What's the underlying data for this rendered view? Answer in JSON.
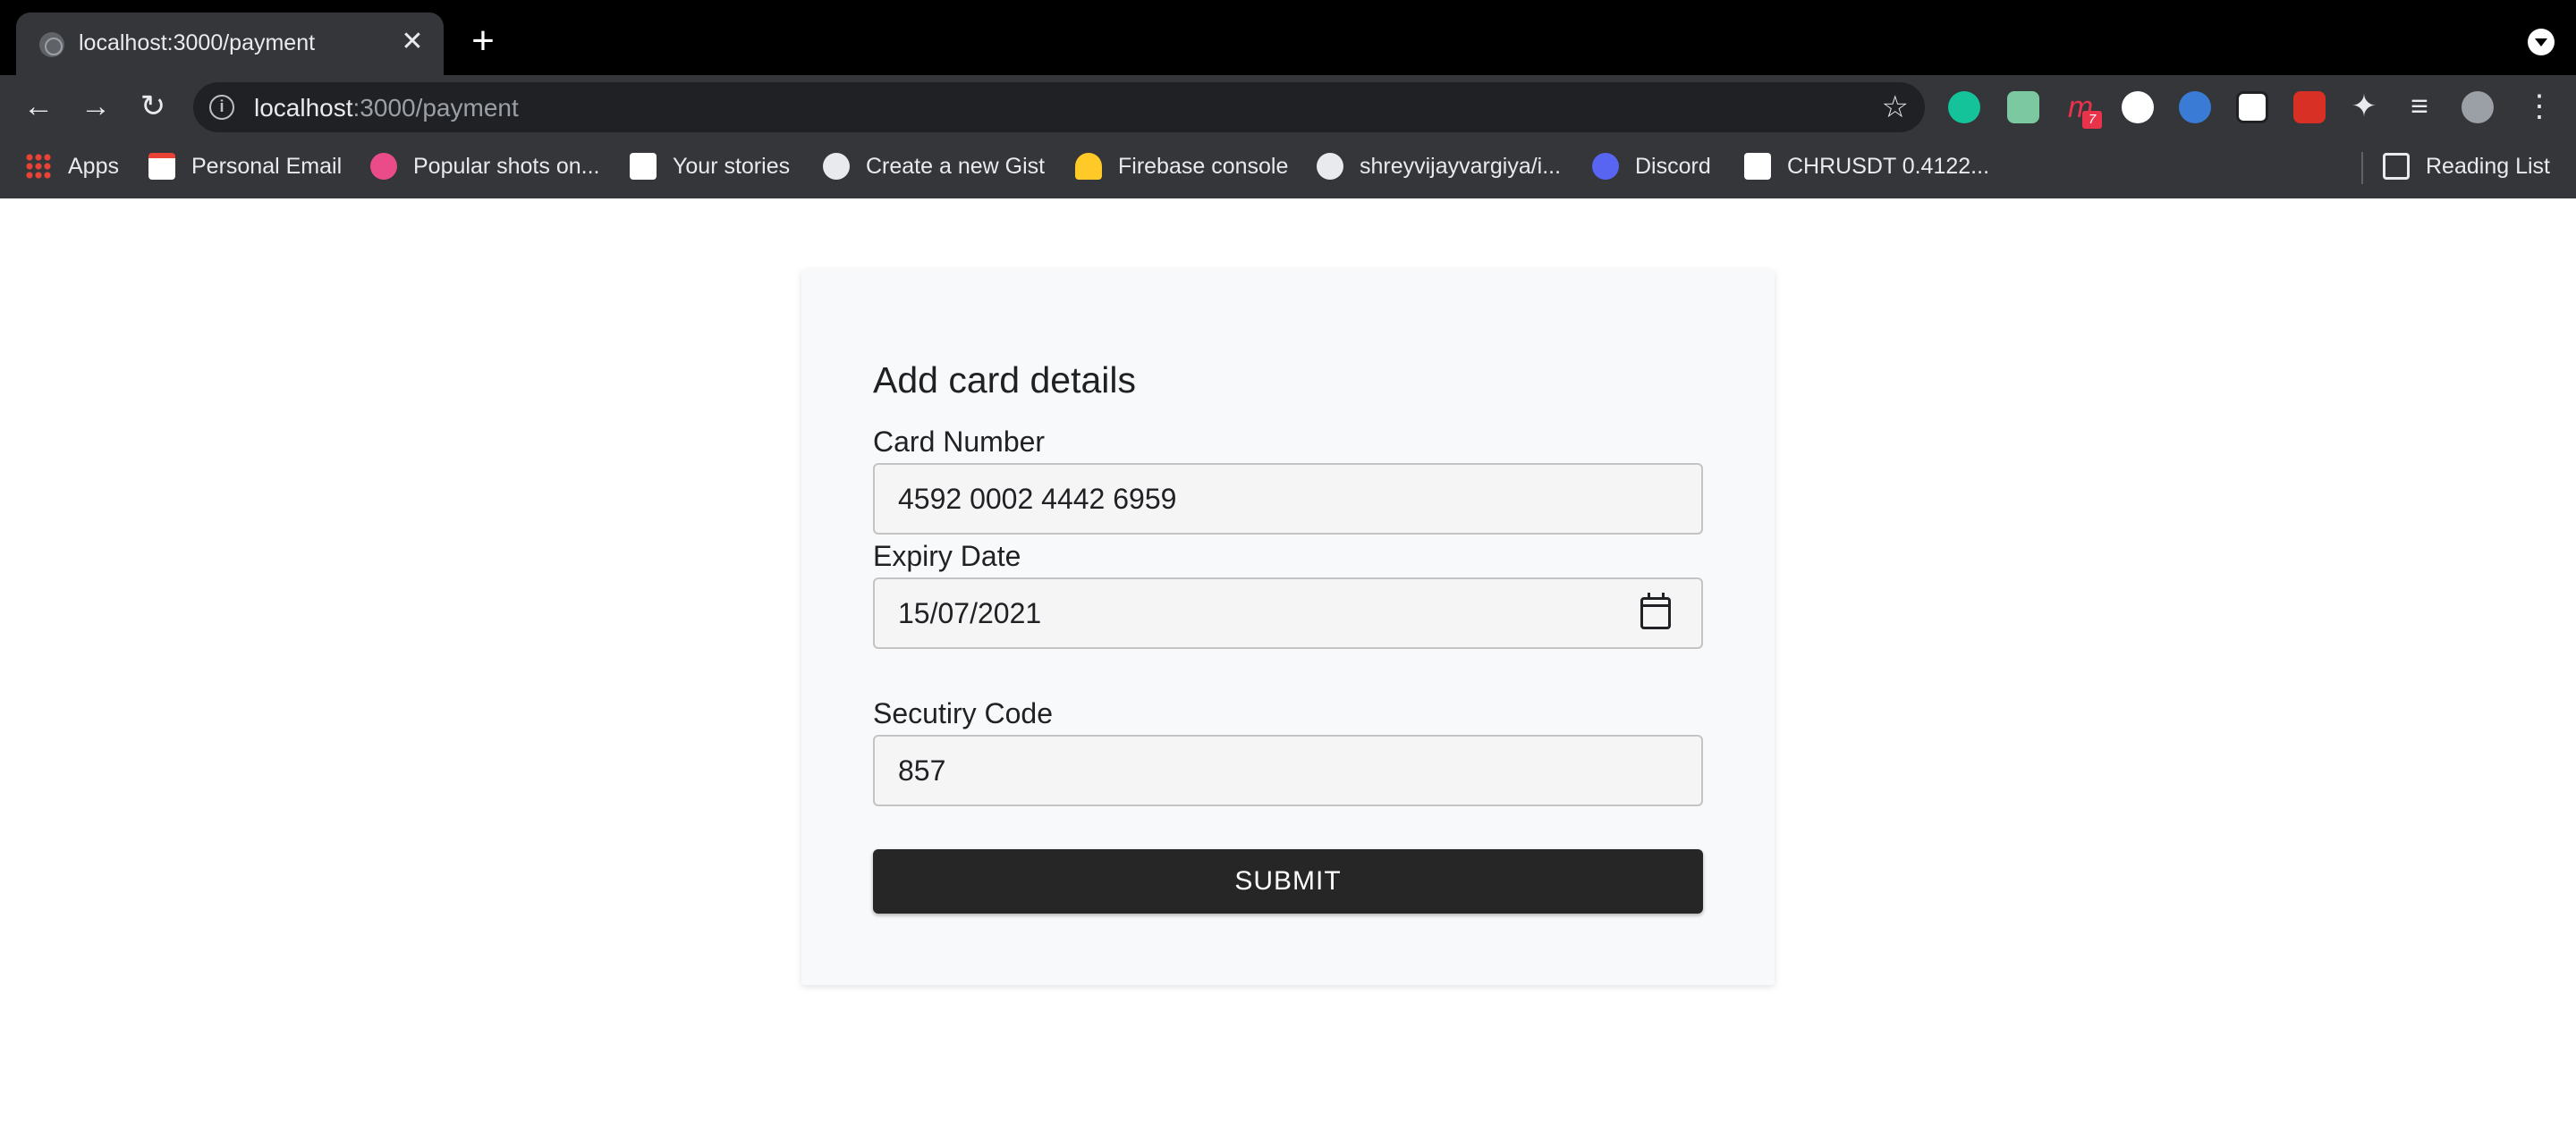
{
  "browser": {
    "tab": {
      "title": "localhost:3000/payment",
      "close_glyph": "✕"
    },
    "new_tab_glyph": "+",
    "address": {
      "host": "localhost",
      "path": ":3000/payment"
    },
    "nav": {
      "back_glyph": "←",
      "forward_glyph": "→",
      "reload_glyph": "↻"
    },
    "extensions": [
      {
        "icon": "grammarly-icon",
        "color": "#15c39a"
      },
      {
        "icon": "mail-extension-icon",
        "color": "#7cc9a1"
      },
      {
        "icon": "m-extension-icon",
        "color": "#e8334a",
        "badge": "7"
      },
      {
        "icon": "code-extension-icon",
        "color": "#ffffff"
      },
      {
        "icon": "globe-extension-icon",
        "color": "#3a7bd5"
      },
      {
        "icon": "notion-icon",
        "color": "#ffffff"
      },
      {
        "icon": "red-extension-icon",
        "color": "#d93025"
      },
      {
        "icon": "puzzle-icon",
        "color": "#e8eaed"
      },
      {
        "icon": "reading-list-queue-icon",
        "color": "#e8eaed"
      },
      {
        "icon": "profile-avatar",
        "color": "#9aa0a6"
      }
    ],
    "bookmarks": [
      {
        "label": "Apps",
        "icon": "apps-grid-icon"
      },
      {
        "label": "Personal Email",
        "icon": "gmail-icon"
      },
      {
        "label": "Popular shots on...",
        "icon": "dribbble-icon"
      },
      {
        "label": "Your stories",
        "icon": "medium-icon"
      },
      {
        "label": "Create a new Gist",
        "icon": "github-icon"
      },
      {
        "label": "Firebase console",
        "icon": "firebase-icon"
      },
      {
        "label": "shreyvijayvargiya/i...",
        "icon": "github-icon"
      },
      {
        "label": "Discord",
        "icon": "discord-icon"
      },
      {
        "label": "CHRUSDT 0.4122...",
        "icon": "tradingview-icon"
      }
    ],
    "reading_list": "Reading List"
  },
  "form": {
    "heading": "Add card details",
    "card_number_label": "Card Number",
    "card_number_value": "4592 0002 4442 6959",
    "expiry_label": "Expiry Date",
    "expiry_value": "15/07/2021",
    "security_label": "Secutiry Code",
    "security_value": "857",
    "submit_label": "SUBMIT"
  }
}
